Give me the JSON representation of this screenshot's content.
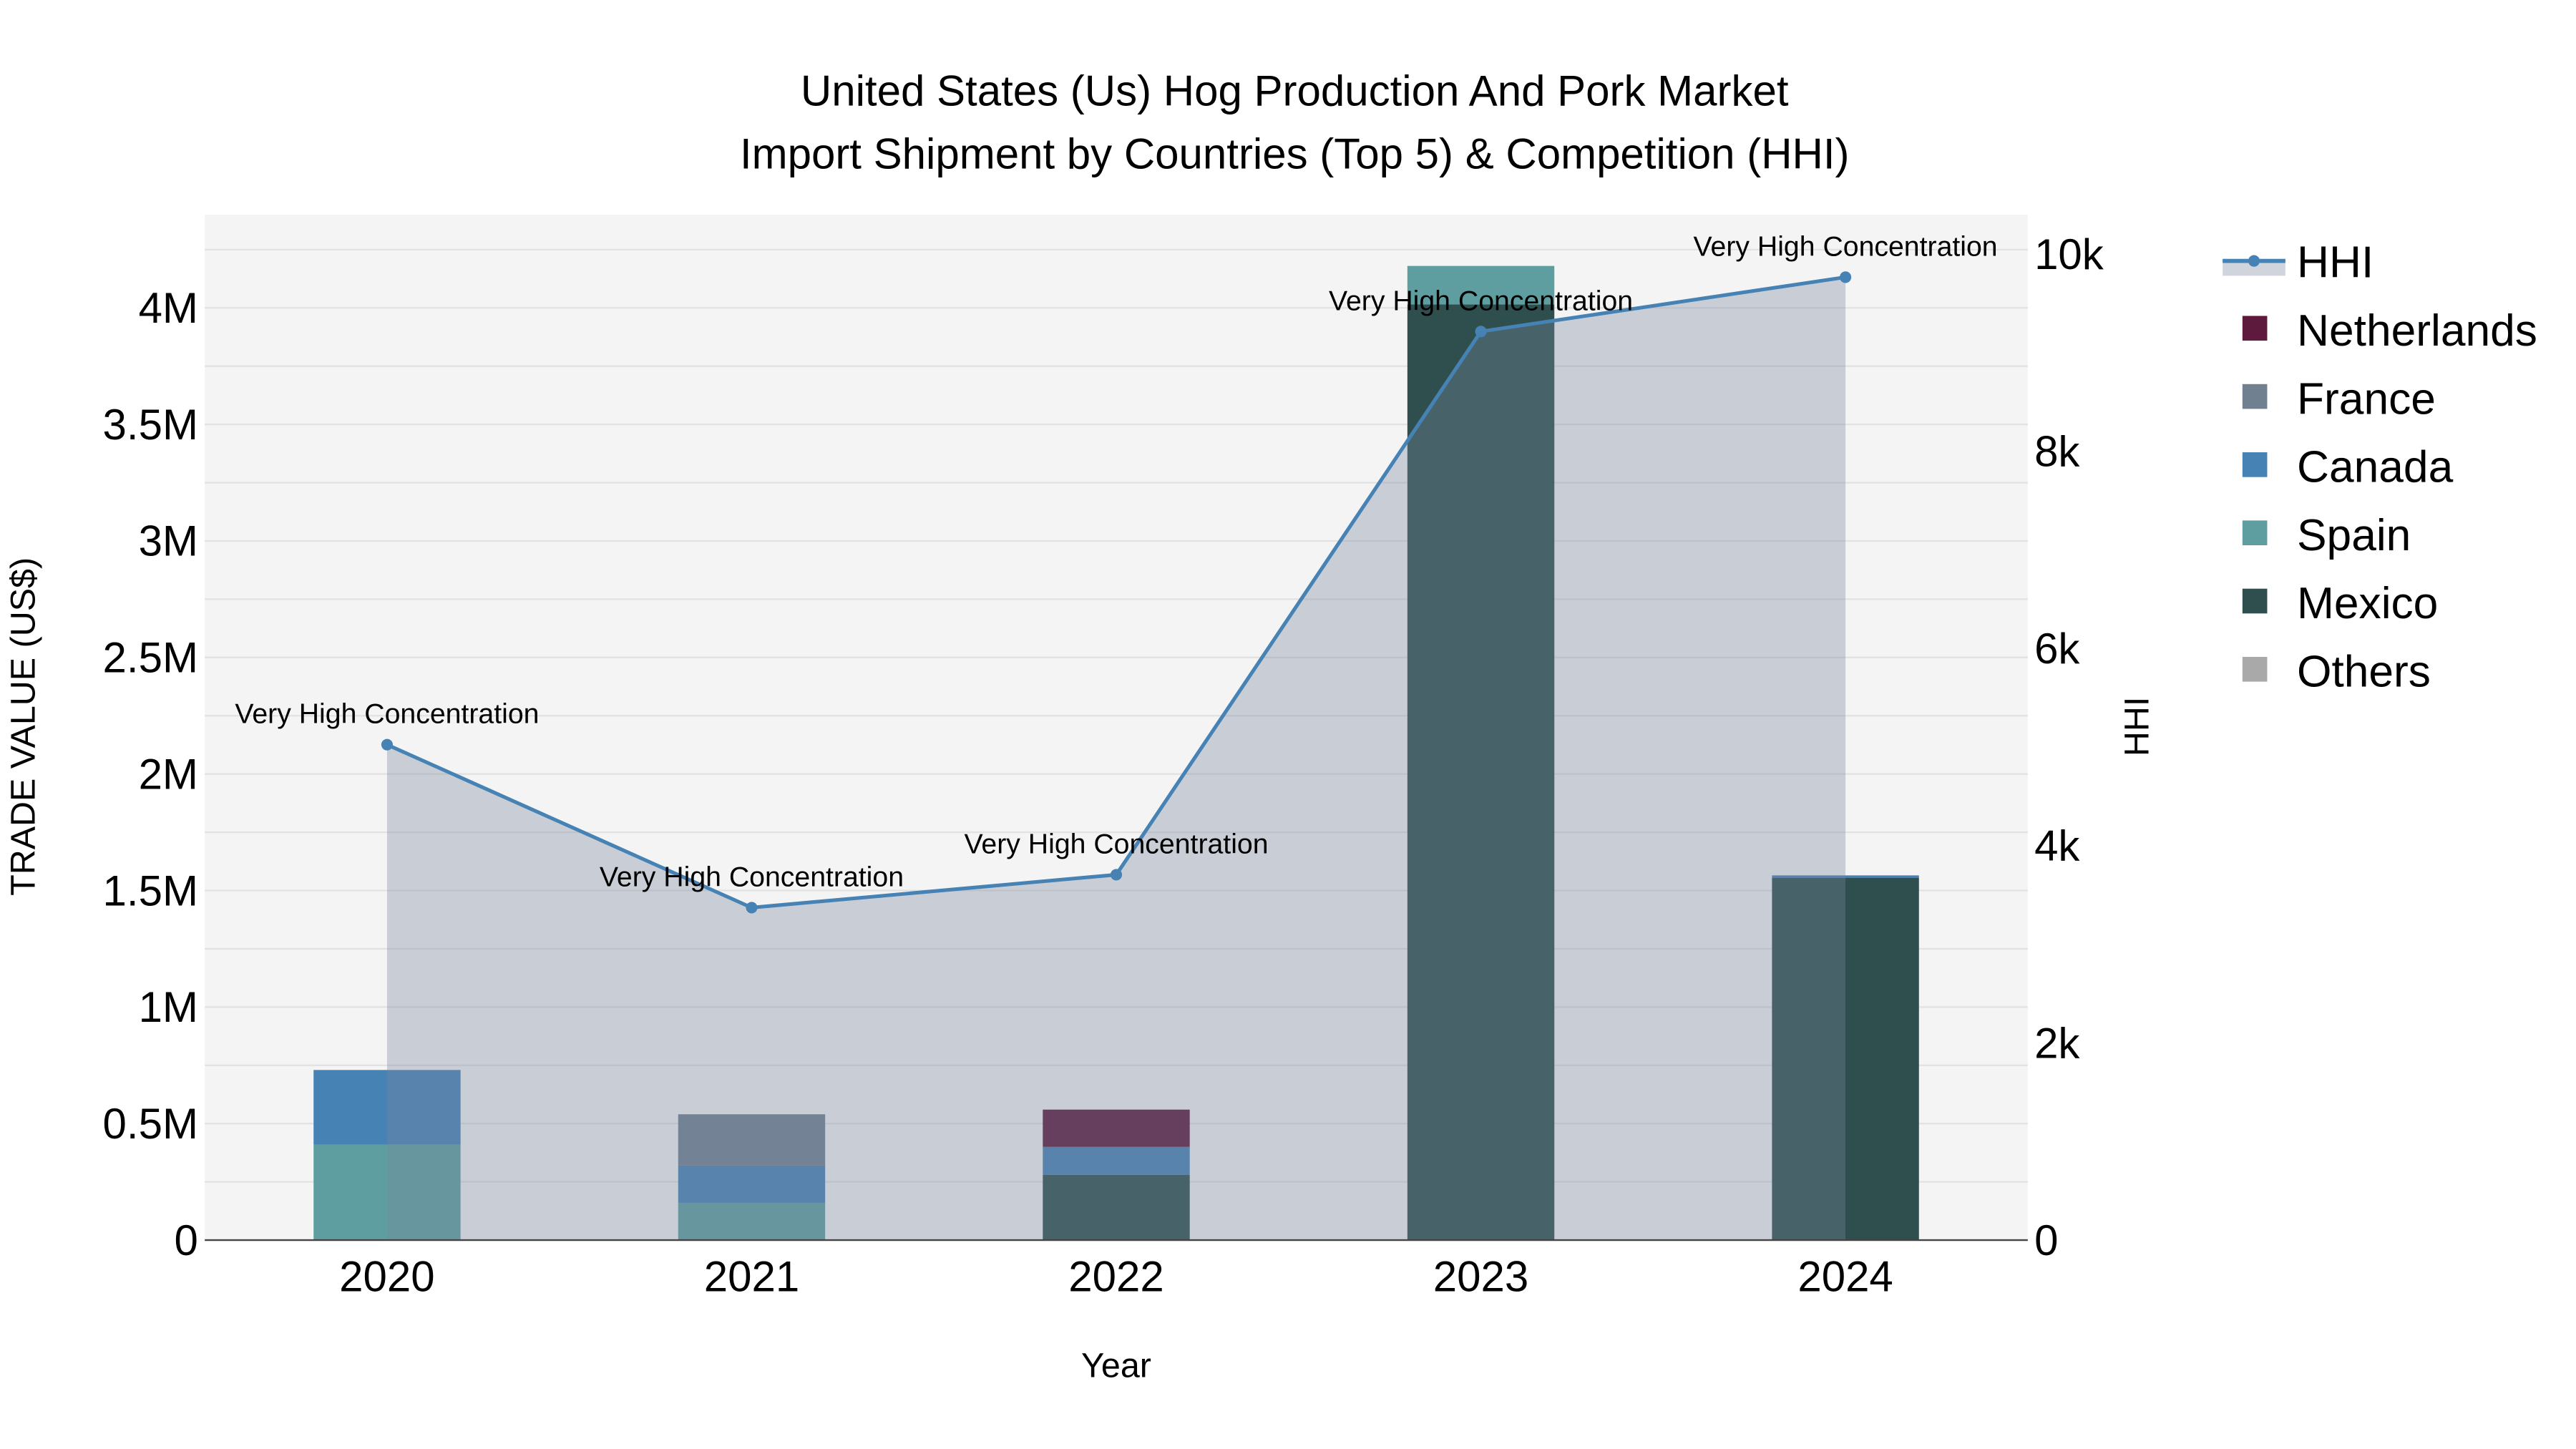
{
  "chart_data": {
    "type": "bar",
    "title_line1": "United States (Us) Hog Production And Pork Market",
    "title_line2": "Import Shipment by Countries (Top 5) & Competition (HHI)",
    "xlabel": "Year",
    "ylabel": "TRADE VALUE (US$)",
    "y2label": "HHI",
    "categories": [
      "2020",
      "2021",
      "2022",
      "2023",
      "2024"
    ],
    "ylim": [
      0,
      4400000
    ],
    "y2lim": [
      0,
      10400
    ],
    "yticks": [
      0,
      500000,
      1000000,
      1500000,
      2000000,
      2500000,
      3000000,
      3500000,
      4000000
    ],
    "ytick_labels": [
      "0",
      "0.5M",
      "1M",
      "1.5M",
      "2M",
      "2.5M",
      "3M",
      "3.5M",
      "4M"
    ],
    "y2ticks": [
      0,
      2000,
      4000,
      6000,
      8000,
      10000
    ],
    "y2tick_labels": [
      "0",
      "2k",
      "4k",
      "6k",
      "8k",
      "10k"
    ],
    "series": [
      {
        "name": "Mexico",
        "color": "#2f4f4f",
        "values": [
          0,
          0,
          280000,
          4015000,
          1555000
        ]
      },
      {
        "name": "Spain",
        "color": "#5f9ea0",
        "values": [
          410000,
          160000,
          0,
          165000,
          0
        ]
      },
      {
        "name": "Canada",
        "color": "#4682b4",
        "values": [
          320000,
          160000,
          120000,
          0,
          10000
        ]
      },
      {
        "name": "France",
        "color": "#708090",
        "values": [
          0,
          220000,
          0,
          0,
          0
        ]
      },
      {
        "name": "Netherlands",
        "color": "#5e1a3c",
        "values": [
          0,
          0,
          160000,
          0,
          0
        ]
      },
      {
        "name": "Others",
        "color": "#a9a9a9",
        "values": [
          0,
          0,
          0,
          0,
          0
        ]
      }
    ],
    "hhi": {
      "name": "HHI",
      "color": "#4682b4",
      "values": [
        5025,
        3372,
        3706,
        9215,
        9766
      ],
      "annotations": [
        "Very High Concentration",
        "Very High Concentration",
        "Very High Concentration",
        "Very High Concentration",
        "Very High Concentration"
      ]
    },
    "legend": [
      "HHI",
      "Netherlands",
      "France",
      "Canada",
      "Spain",
      "Mexico",
      "Others"
    ],
    "legend_position": "right",
    "grid": true
  }
}
